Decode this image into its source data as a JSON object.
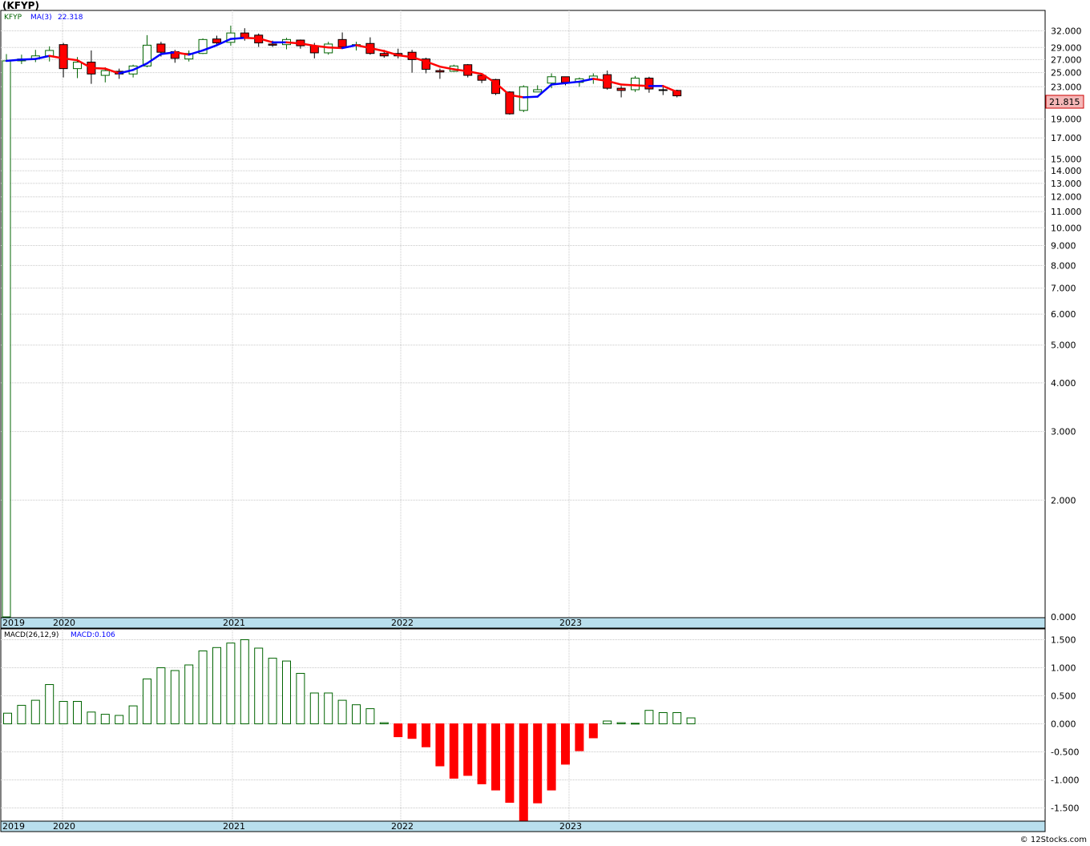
{
  "title": "(KFYP)",
  "footer": "© 12Stocks.com",
  "price_panel": {
    "symbol_label": "KFYP",
    "ma_label": "MA(3)",
    "ma_value": "22.318",
    "last_price": "21.815",
    "y_ticks": [
      "32.000",
      "29.000",
      "27.000",
      "25.000",
      "23.000",
      "19.000",
      "17.000",
      "15.000",
      "14.000",
      "13.000",
      "12.000",
      "11.000",
      "10.000",
      "9.000",
      "8.000",
      "7.000",
      "6.000",
      "5.000",
      "4.000",
      "3.000",
      "2.000",
      "0.000"
    ]
  },
  "macd_panel": {
    "label": "MACD(26,12,9)",
    "value_label": "MACD:0.106",
    "y_ticks": [
      "1.500",
      "1.000",
      "0.500",
      "0.000",
      "-0.500",
      "-1.000",
      "-1.500"
    ]
  },
  "x_axis": {
    "labels": [
      "2019",
      "2020",
      "2021",
      "2022",
      "2023"
    ]
  },
  "colors": {
    "up": "#006400",
    "down": "#ff0000",
    "ma_up": "#0000ff",
    "ma_down": "#ff0000",
    "axis_band": "#b9dfed"
  },
  "chart_data": [
    {
      "type": "candlestick",
      "scale": "log",
      "series": [
        {
          "name": "KFYP",
          "x_months": [
            "2019-11",
            "2019-12",
            "2020-01",
            "2020-02",
            "2020-03",
            "2020-04",
            "2020-05",
            "2020-06",
            "2020-07",
            "2020-08",
            "2020-09",
            "2020-10",
            "2020-11",
            "2020-12",
            "2021-01",
            "2021-02",
            "2021-03",
            "2021-04",
            "2021-05",
            "2021-06",
            "2021-07",
            "2021-08",
            "2021-09",
            "2021-10",
            "2021-11",
            "2021-12",
            "2022-01",
            "2022-02",
            "2022-03",
            "2022-04",
            "2022-05",
            "2022-06",
            "2022-07",
            "2022-08",
            "2022-09",
            "2022-10",
            "2022-11",
            "2022-12",
            "2023-01",
            "2023-02",
            "2023-03",
            "2023-04",
            "2023-05",
            "2023-06",
            "2023-07",
            "2023-08",
            "2023-09"
          ]
        }
      ],
      "ohlc": [
        [
          0,
          27.9,
          0,
          26.8
        ],
        [
          26.8,
          27.8,
          26.3,
          27.1
        ],
        [
          27.1,
          28.6,
          26.6,
          27.6
        ],
        [
          27.6,
          29.2,
          26.7,
          28.5
        ],
        [
          29.5,
          29.8,
          24.3,
          25.6
        ],
        [
          25.6,
          27.4,
          24.2,
          26.6
        ],
        [
          26.6,
          28.5,
          23.4,
          24.8
        ],
        [
          24.6,
          25.8,
          23.6,
          25.3
        ],
        [
          25.2,
          25.6,
          24.1,
          24.8
        ],
        [
          24.8,
          26.2,
          24.3,
          26.0
        ],
        [
          26.0,
          31.2,
          25.8,
          29.4
        ],
        [
          29.6,
          30.0,
          27.5,
          28.2
        ],
        [
          28.3,
          28.6,
          26.5,
          27.2
        ],
        [
          27.1,
          28.5,
          26.7,
          28.0
        ],
        [
          28.0,
          30.6,
          27.9,
          30.4
        ],
        [
          30.5,
          31.1,
          29.3,
          29.8
        ],
        [
          29.9,
          33.0,
          29.3,
          31.6
        ],
        [
          31.6,
          32.5,
          30.2,
          30.8
        ],
        [
          31.2,
          31.5,
          29.1,
          29.8
        ],
        [
          29.6,
          30.2,
          29.1,
          29.4
        ],
        [
          29.5,
          30.7,
          28.7,
          30.4
        ],
        [
          30.3,
          30.4,
          28.8,
          29.3
        ],
        [
          29.3,
          29.8,
          27.2,
          28.1
        ],
        [
          28.1,
          30.0,
          27.8,
          29.6
        ],
        [
          30.4,
          31.7,
          28.8,
          29.1
        ],
        [
          29.4,
          30.0,
          28.5,
          29.5
        ],
        [
          29.7,
          30.8,
          27.8,
          28.0
        ],
        [
          28.0,
          28.6,
          27.3,
          27.6
        ],
        [
          28.0,
          28.8,
          27.2,
          27.6
        ],
        [
          28.2,
          28.6,
          25.0,
          27.0
        ],
        [
          27.1,
          27.3,
          24.9,
          25.5
        ],
        [
          25.3,
          25.6,
          24.1,
          25.1
        ],
        [
          25.2,
          26.2,
          25.1,
          26.0
        ],
        [
          26.2,
          26.3,
          24.3,
          24.6
        ],
        [
          24.6,
          24.9,
          23.5,
          23.9
        ],
        [
          24.0,
          24.1,
          21.9,
          22.1
        ],
        [
          22.3,
          22.4,
          19.5,
          19.6
        ],
        [
          20.0,
          23.2,
          19.8,
          23.0
        ],
        [
          22.3,
          23.2,
          22.3,
          22.6
        ],
        [
          23.5,
          24.9,
          22.8,
          24.4
        ],
        [
          24.4,
          24.4,
          23.2,
          23.6
        ],
        [
          23.6,
          24.3,
          23.0,
          24.1
        ],
        [
          24.1,
          24.9,
          23.4,
          24.5
        ],
        [
          24.7,
          25.3,
          22.6,
          22.8
        ],
        [
          22.8,
          23.1,
          21.6,
          22.5
        ],
        [
          22.6,
          24.5,
          22.3,
          24.2
        ],
        [
          24.2,
          24.4,
          22.2,
          22.7
        ],
        [
          22.6,
          23.0,
          21.9,
          22.5
        ],
        [
          22.5,
          22.6,
          21.6,
          21.8
        ]
      ],
      "ma3": [
        26.8,
        27.0,
        27.1,
        27.6,
        27.2,
        26.9,
        25.7,
        25.6,
        24.9,
        25.4,
        26.4,
        27.9,
        28.2,
        27.8,
        28.5,
        29.4,
        30.5,
        30.7,
        30.6,
        29.9,
        29.9,
        29.7,
        29.3,
        29.0,
        28.9,
        29.4,
        28.9,
        28.4,
        27.7,
        27.4,
        26.7,
        25.9,
        25.5,
        25.2,
        24.8,
        23.5,
        21.9,
        21.6,
        21.7,
        23.3,
        23.5,
        23.7,
        24.1,
        23.8,
        23.3,
        23.2,
        23.1,
        23.1,
        22.3
      ],
      "y_min_label": "0.000"
    },
    {
      "type": "bar",
      "name": "MACD(26,12,9)",
      "values": [
        0.19,
        0.33,
        0.42,
        0.7,
        0.4,
        0.4,
        0.21,
        0.17,
        0.15,
        0.32,
        0.8,
        1.0,
        0.95,
        1.05,
        1.3,
        1.36,
        1.44,
        1.5,
        1.35,
        1.17,
        1.12,
        0.9,
        0.55,
        0.55,
        0.42,
        0.34,
        0.27,
        0.02,
        -0.23,
        -0.26,
        -0.41,
        -0.75,
        -0.97,
        -0.92,
        -1.07,
        -1.18,
        -1.4,
        -1.75,
        -1.41,
        -1.18,
        -0.72,
        -0.48,
        -0.25,
        0.05,
        0.02,
        0.01,
        0.24,
        0.2,
        0.2,
        0.106
      ],
      "ylim": [
        -1.75,
        1.6
      ]
    }
  ]
}
